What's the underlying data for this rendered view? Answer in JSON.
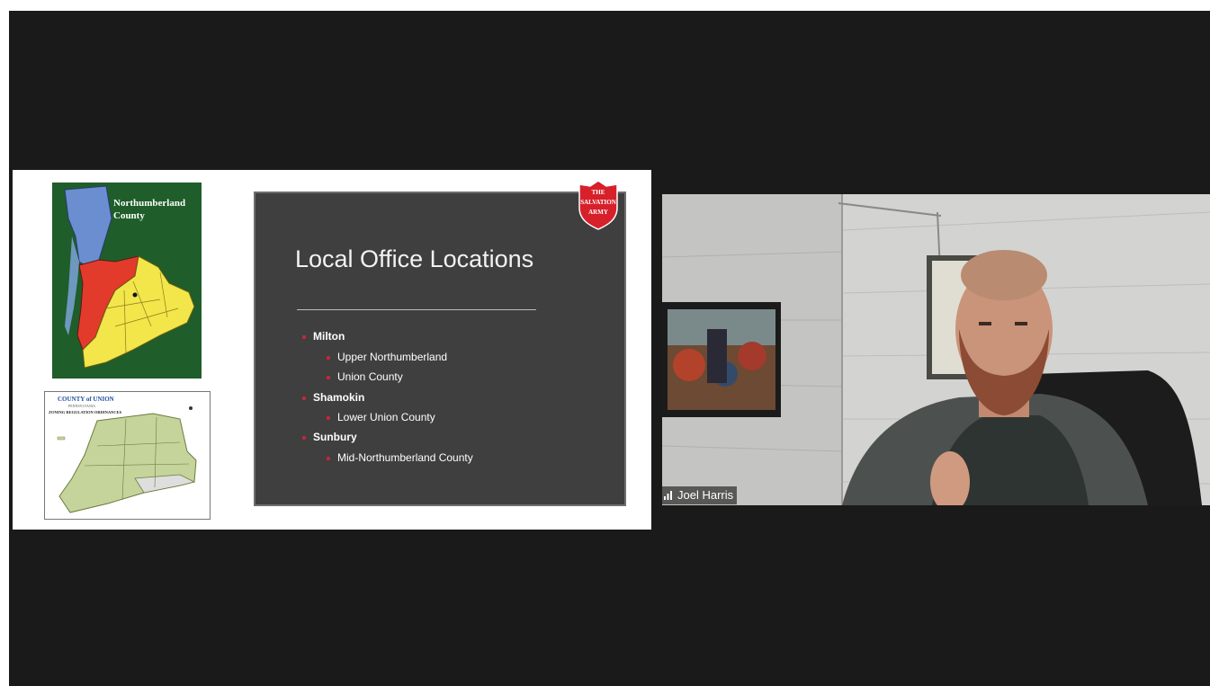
{
  "shared_slide": {
    "north_map": {
      "title_line1": "Northumberland",
      "title_line2": "County"
    },
    "union_map": {
      "header": "COUNTY of UNION",
      "subheader": "PENNSYLVANIA",
      "caption": "ZONING REGULATION ORDINANCES"
    },
    "title": "Local Office Locations",
    "bullets": [
      {
        "text": "Milton",
        "level": 1
      },
      {
        "text": "Upper Northumberland",
        "level": 2
      },
      {
        "text": "Union County",
        "level": 2
      },
      {
        "text": "Shamokin",
        "level": 1
      },
      {
        "text": "Lower Union County",
        "level": 2
      },
      {
        "text": "Sunbury",
        "level": 1
      },
      {
        "text": "Mid-Northumberland County",
        "level": 2
      }
    ],
    "logo_text": [
      "THE",
      "SALVATION",
      "ARMY"
    ]
  },
  "participant": {
    "name": "Joel Harris"
  },
  "colors": {
    "background": "#1a1a1a",
    "slide_bg": "#3f3f3f",
    "bullet_accent": "#c0283c",
    "logo_red": "#d6202a"
  }
}
